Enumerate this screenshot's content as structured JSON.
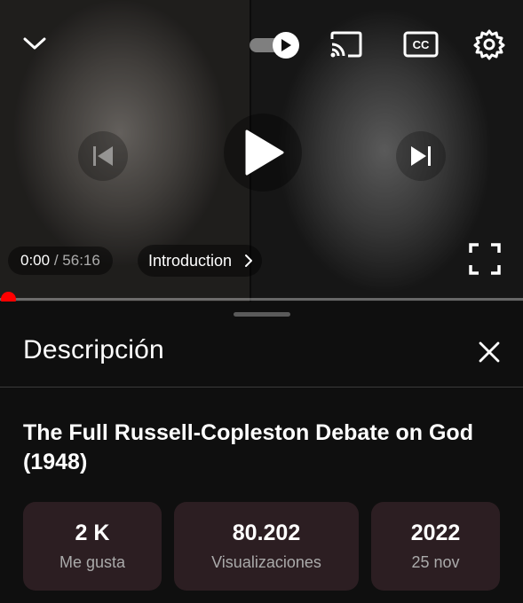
{
  "player": {
    "time_current": "0:00",
    "time_separator": "/",
    "time_total": "56:16",
    "chapter": "Introduction",
    "progress_fraction": 0.0,
    "icons": [
      "chevron-down-icon",
      "autoplay-icon",
      "cast-icon",
      "cc-icon",
      "settings-icon",
      "previous-icon",
      "play-icon",
      "next-icon",
      "chevron-right-icon",
      "fullscreen-icon"
    ],
    "cc_label": "CC",
    "accent_color": "#ff0000"
  },
  "sheet": {
    "heading": "Descripción",
    "video_title": "The Full Russell-Copleston Debate on God (1948)",
    "stats": {
      "likes_value": "2 K",
      "likes_label": "Me gusta",
      "views_value": "80.202",
      "views_label": "Visualizaciones",
      "year_value": "2022",
      "date_label": "25 nov"
    },
    "stat_background": "#2c1e22"
  }
}
